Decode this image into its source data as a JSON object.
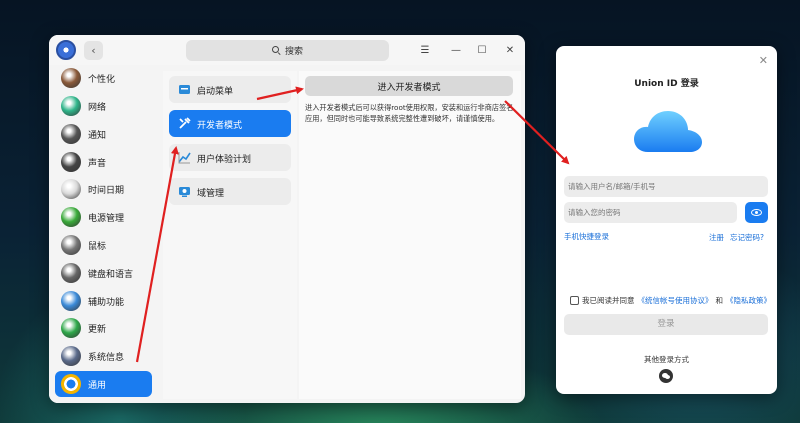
{
  "control_center": {
    "search_placeholder": "搜索",
    "sidebar": [
      {
        "label": "个性化",
        "icon": "personalization-icon",
        "color": "#8a5a3a",
        "active": false
      },
      {
        "label": "网络",
        "icon": "network-icon",
        "color": "#2fb58a",
        "active": false
      },
      {
        "label": "通知",
        "icon": "bell-icon",
        "color": "#555555",
        "active": false
      },
      {
        "label": "声音",
        "icon": "speaker-icon",
        "color": "#444444",
        "active": false
      },
      {
        "label": "时间日期",
        "icon": "clock-icon",
        "color": "#d9d9d9",
        "active": false
      },
      {
        "label": "电源管理",
        "icon": "battery-icon",
        "color": "#3aaa3a",
        "active": false
      },
      {
        "label": "鼠标",
        "icon": "mouse-icon",
        "color": "#777777",
        "active": false
      },
      {
        "label": "键盘和语言",
        "icon": "keyboard-icon",
        "color": "#666666",
        "active": false
      },
      {
        "label": "辅助功能",
        "icon": "accessibility-icon",
        "color": "#3a8ad8",
        "active": false
      },
      {
        "label": "更新",
        "icon": "update-icon",
        "color": "#2fa84a",
        "active": false
      },
      {
        "label": "系统信息",
        "icon": "system-info-icon",
        "color": "#5a6a8a",
        "active": false
      },
      {
        "label": "通用",
        "icon": "general-icon",
        "color": "#ffffff",
        "active": true
      }
    ],
    "sub_items": [
      {
        "label": "启动菜单",
        "icon": "boot-menu-icon",
        "active": false
      },
      {
        "label": "开发者模式",
        "icon": "developer-tools-icon",
        "active": true
      },
      {
        "label": "用户体验计划",
        "icon": "user-experience-icon",
        "active": false
      },
      {
        "label": "域管理",
        "icon": "domain-management-icon",
        "active": false
      }
    ],
    "dev_mode_button": "进入开发者模式",
    "dev_mode_description": "进入开发者模式后可以获得root使用权限，安装和运行非商店签名应用，但同时也可能导致系统完整性遭到破坏，请谨慎使用。"
  },
  "login": {
    "title": "Union ID 登录",
    "username_placeholder": "请输入用户名/邮箱/手机号",
    "password_placeholder": "请输入您的密码",
    "phone_login": "手机快捷登录",
    "register": "注册",
    "forgot_password": "忘记密码?",
    "agree_prefix": "我已阅读并同意",
    "agreement_link": "《统信帐号使用协议》",
    "agree_and": "和",
    "privacy_link": "《隐私政策》",
    "login_button": "登录",
    "other_methods": "其他登录方式"
  },
  "colors": {
    "accent": "#1a7cf0",
    "annotation_arrow": "#e02020"
  }
}
